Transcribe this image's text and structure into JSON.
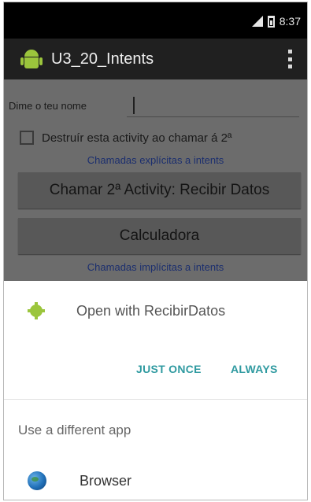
{
  "status_bar": {
    "time": "8:37",
    "signal_icon": "signal-icon",
    "battery_icon": "battery-icon"
  },
  "action_bar": {
    "title": "U3_20_Intents",
    "app_icon": "android-icon",
    "menu_icon": "overflow-menu-icon"
  },
  "form": {
    "name_label": "Dime o teu nome",
    "name_value": "",
    "checkbox_label": "Destruír esta activity ao chamar á 2ª",
    "checkbox_checked": false,
    "explicit_section": "Chamadas explícitas a intents",
    "button_recibir": "Chamar 2ª Activity: Recibir Datos",
    "button_calc": "Calculadora",
    "implicit_section": "Chamadas implícitas a intents"
  },
  "chooser": {
    "open_with": "Open with RecibirDatos",
    "app_icon": "gear-app-icon",
    "just_once": "JUST ONCE",
    "always": "ALWAYS",
    "different_app": "Use a different app",
    "apps": [
      {
        "label": "Browser",
        "icon": "globe-icon"
      }
    ]
  },
  "colors": {
    "accent": "#2f9aa0",
    "android_green": "#9bc53c",
    "section_link": "#1b2e6e"
  }
}
